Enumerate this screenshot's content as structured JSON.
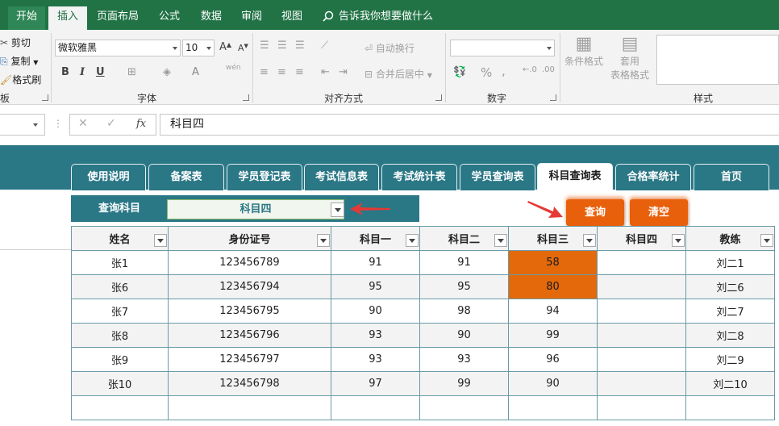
{
  "ribbon_tabs": [
    {
      "label": "开始",
      "active": false
    },
    {
      "label": "插入",
      "active": true
    },
    {
      "label": "页面布局",
      "active": false
    },
    {
      "label": "公式",
      "active": false
    },
    {
      "label": "数据",
      "active": false
    },
    {
      "label": "审阅",
      "active": false
    },
    {
      "label": "视图",
      "active": false
    }
  ],
  "tell_me": "告诉我你想要做什么",
  "clipboard": {
    "cut": "剪切",
    "copy": "复制",
    "format_painter": "格式刷",
    "label": "板"
  },
  "font": {
    "name": "微软雅黑",
    "size": "10",
    "label": "字体",
    "bold": "B",
    "italic": "I",
    "underline": "U",
    "grow": "A",
    "shrink": "A",
    "font_color": "A",
    "phonetic": "wén"
  },
  "alignment": {
    "wrap_text": "自动换行",
    "merge_center": "合并后居中",
    "label": "对齐方式"
  },
  "number": {
    "label": "数字",
    "percent": "%",
    "comma": ","
  },
  "styles": {
    "conditional": "条件格式",
    "format_table_1": "套用",
    "format_table_2": "表格格式",
    "label": "样式"
  },
  "formula_bar": {
    "cancel": "✕",
    "enter": "✓",
    "fx": "fx",
    "value": "科目四"
  },
  "nav_tabs": [
    {
      "label": "使用说明",
      "active": false
    },
    {
      "label": "备案表",
      "active": false
    },
    {
      "label": "学员登记表",
      "active": false
    },
    {
      "label": "考试信息表",
      "active": false
    },
    {
      "label": "考试统计表",
      "active": false
    },
    {
      "label": "学员查询表",
      "active": false
    },
    {
      "label": "科目查询表",
      "active": true
    },
    {
      "label": "合格率统计",
      "active": false
    },
    {
      "label": "首页",
      "active": false
    }
  ],
  "query": {
    "label": "查询科目",
    "selected": "科目四"
  },
  "buttons": {
    "query": "查询",
    "clear": "清空"
  },
  "table": {
    "headers": [
      "姓名",
      "身份证号",
      "科目一",
      "科目二",
      "科目三",
      "科目四",
      "教练"
    ],
    "rows": [
      {
        "name": "张1",
        "id": "123456789",
        "s1": "91",
        "s2": "91",
        "s3": "58",
        "s4": "",
        "coach": "刘二1",
        "s3_low": true
      },
      {
        "name": "张6",
        "id": "123456794",
        "s1": "95",
        "s2": "95",
        "s3": "80",
        "s4": "",
        "coach": "刘二6",
        "s3_low": true
      },
      {
        "name": "张7",
        "id": "123456795",
        "s1": "90",
        "s2": "98",
        "s3": "94",
        "s4": "",
        "coach": "刘二7",
        "s3_low": false
      },
      {
        "name": "张8",
        "id": "123456796",
        "s1": "93",
        "s2": "90",
        "s3": "99",
        "s4": "",
        "coach": "刘二8",
        "s3_low": false
      },
      {
        "name": "张9",
        "id": "123456797",
        "s1": "93",
        "s2": "93",
        "s3": "96",
        "s4": "",
        "coach": "刘二9",
        "s3_low": false
      },
      {
        "name": "张10",
        "id": "123456798",
        "s1": "97",
        "s2": "99",
        "s3": "90",
        "s4": "",
        "coach": "刘二10",
        "s3_low": false
      }
    ]
  },
  "colors": {
    "excel_green": "#217346",
    "teal": "#2a7786",
    "orange": "#e8600c",
    "highlight": "#e3690b",
    "arrow_red": "#e53935"
  }
}
